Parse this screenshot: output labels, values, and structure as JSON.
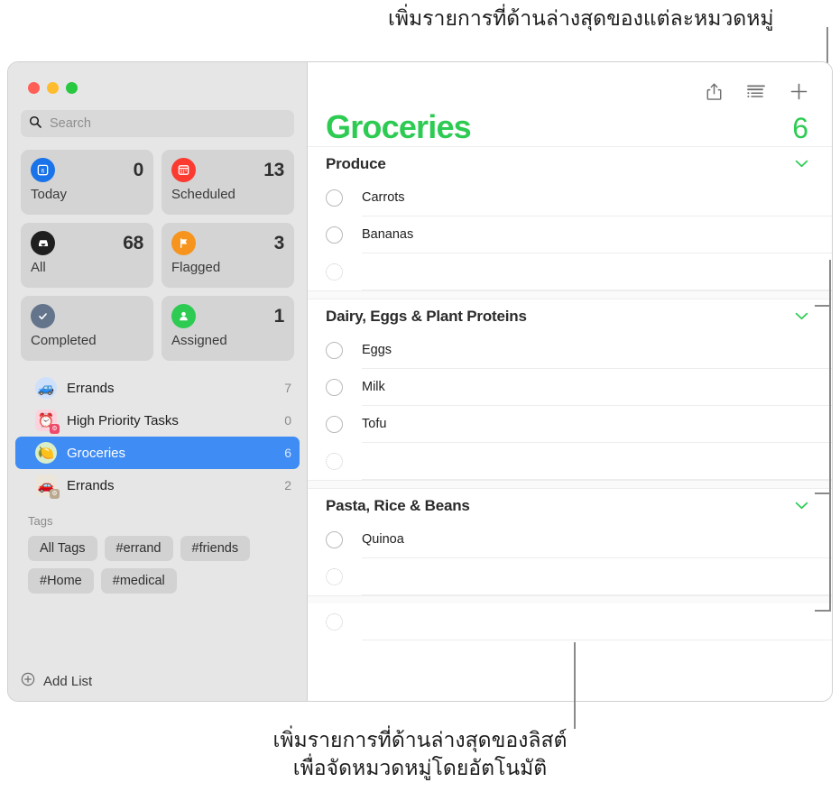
{
  "annotations": {
    "top": "เพิ่มรายการที่ด้านล่างสุดของแต่ละหมวดหมู่",
    "bottom_line1": "เพิ่มรายการที่ด้านล่างสุดของลิสต์",
    "bottom_line2": "เพื่อจัดหมวดหมู่โดยอัตโนมัติ"
  },
  "colors": {
    "accent_green": "#2ECB53",
    "selection_blue": "#3f8cf4",
    "sidebar_bg": "#e6e6e6"
  },
  "sidebar": {
    "search": {
      "placeholder": "Search",
      "value": "",
      "icon": "search-icon"
    },
    "smart_lists": [
      {
        "label": "Today",
        "count": "0",
        "icon": "calendar-day-icon",
        "color": "#1a73e8"
      },
      {
        "label": "Scheduled",
        "count": "13",
        "icon": "calendar-icon",
        "color": "#fc3b30"
      },
      {
        "label": "All",
        "count": "68",
        "icon": "inbox-tray-icon",
        "color": "#1f1f1f"
      },
      {
        "label": "Flagged",
        "count": "3",
        "icon": "flag-icon",
        "color": "#f7941d"
      },
      {
        "label": "Completed",
        "count": "",
        "icon": "checkmark-icon",
        "color": "#63748b"
      },
      {
        "label": "Assigned",
        "count": "1",
        "icon": "person-icon",
        "color": "#2ECB53"
      }
    ],
    "lists": [
      {
        "label": "Errands",
        "count": "7",
        "emoji": "🚙",
        "bg": "#cfe0fb",
        "badge": "",
        "selected": false
      },
      {
        "label": "High Priority Tasks",
        "count": "0",
        "emoji": "⏰",
        "bg": "#fcd3dd",
        "badge": "gear",
        "selected": false
      },
      {
        "label": "Groceries",
        "count": "6",
        "emoji": "🍋",
        "bg": "#d9edc8",
        "badge": "",
        "selected": true
      },
      {
        "label": "Errands",
        "count": "2",
        "emoji": "🚗",
        "bg": "#ece5da",
        "badge": "gear",
        "selected": false
      }
    ],
    "tags_header": "Tags",
    "tags": [
      "All Tags",
      "#errand",
      "#friends",
      "#Home",
      "#medical"
    ],
    "add_list": {
      "label": "Add List",
      "icon": "plus-circle-icon"
    }
  },
  "main": {
    "toolbar": [
      {
        "name": "share-icon",
        "title": "Share"
      },
      {
        "name": "group-list-icon",
        "title": "View as groups"
      },
      {
        "name": "plus-icon",
        "title": "Add reminder"
      }
    ],
    "title": "Groceries",
    "total": "6",
    "sections": [
      {
        "title": "Produce",
        "chevron": "chevron-down-icon",
        "items": [
          "Carrots",
          "Bananas"
        ],
        "new_item_placeholder": ""
      },
      {
        "title": "Dairy, Eggs & Plant Proteins",
        "chevron": "chevron-down-icon",
        "items": [
          "Eggs",
          "Milk",
          "Tofu"
        ],
        "new_item_placeholder": ""
      },
      {
        "title": "Pasta, Rice & Beans",
        "chevron": "chevron-down-icon",
        "items": [
          "Quinoa"
        ],
        "new_item_placeholder": ""
      }
    ],
    "trailing_new_item_placeholder": ""
  }
}
